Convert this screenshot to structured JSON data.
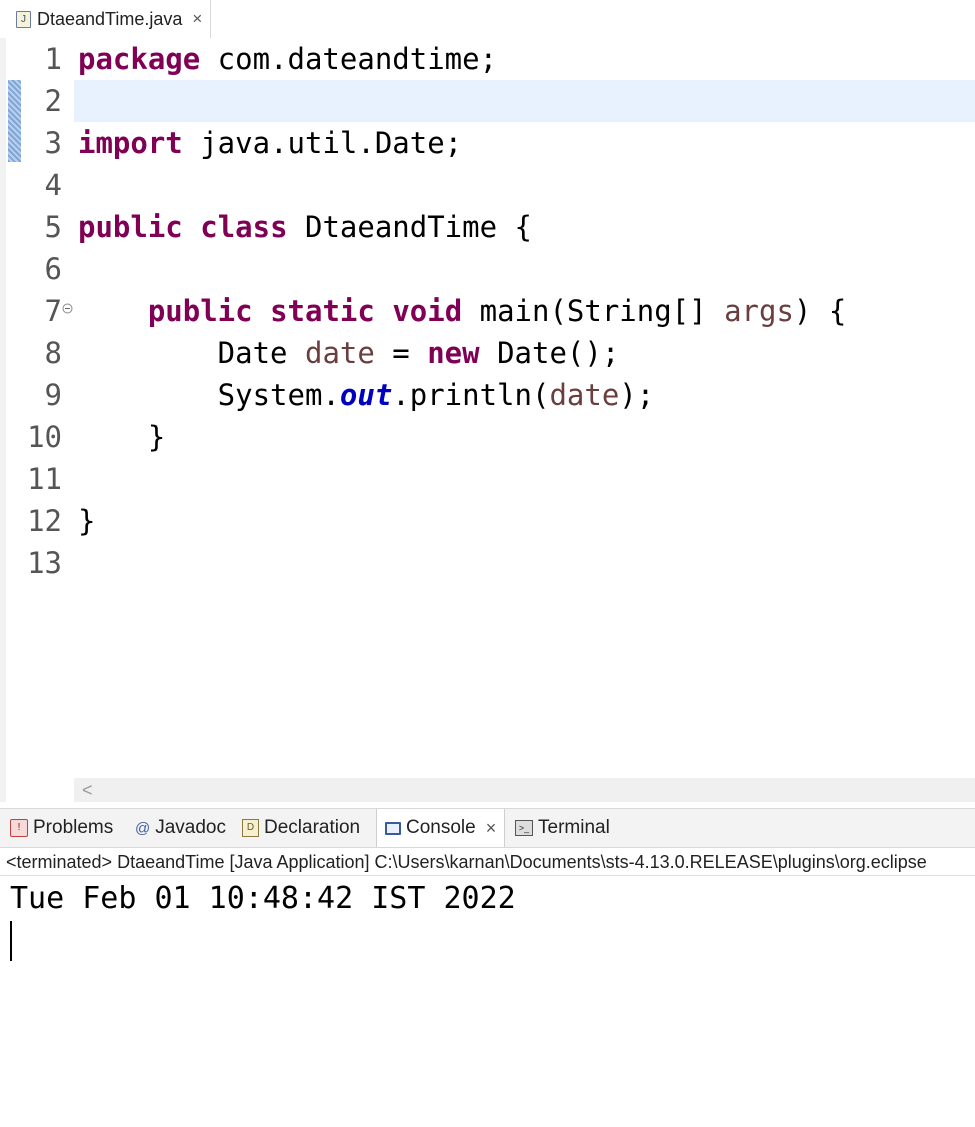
{
  "editor_tab": {
    "icon": "java-file-icon",
    "label": "DtaeandTime.java",
    "close": "×"
  },
  "line_numbers": [
    "1",
    "2",
    "3",
    "4",
    "5",
    "6",
    "7",
    "8",
    "9",
    "10",
    "11",
    "12",
    "13"
  ],
  "code": {
    "l1_kw": "package",
    "l1_rest": " com.dateandtime;",
    "l3_kw": "import",
    "l3_rest": " java.util.Date;",
    "l5_kw1": "public",
    "l5_kw2": "class",
    "l5_rest": " DtaeandTime {",
    "l7_indent": "    ",
    "l7_kw1": "public",
    "l7_kw2": "static",
    "l7_kw3": "void",
    "l7_mid": " main(String[] ",
    "l7_var": "args",
    "l7_end": ") {",
    "l8_start": "        Date ",
    "l8_var": "date",
    "l8_mid": " = ",
    "l8_kw": "new",
    "l8_end": " Date();",
    "l9_start": "        System.",
    "l9_field": "out",
    "l9_mid": ".println(",
    "l9_var": "date",
    "l9_end": ");",
    "l10": "    }",
    "l12": "}"
  },
  "scroll_arrow": "<",
  "panel_tabs": [
    {
      "label": "Problems",
      "icon": "problems-icon"
    },
    {
      "label": "Javadoc",
      "icon": "at-icon",
      "glyph": "@"
    },
    {
      "label": "Declaration",
      "icon": "declaration-icon"
    },
    {
      "label": "Console",
      "icon": "console-icon",
      "close": "×"
    },
    {
      "label": "Terminal",
      "icon": "terminal-icon"
    }
  ],
  "console": {
    "header": "<terminated> DtaeandTime [Java Application] C:\\Users\\karnan\\Documents\\sts-4.13.0.RELEASE\\plugins\\org.eclipse",
    "output": "Tue Feb 01 10:48:42 IST 2022"
  }
}
